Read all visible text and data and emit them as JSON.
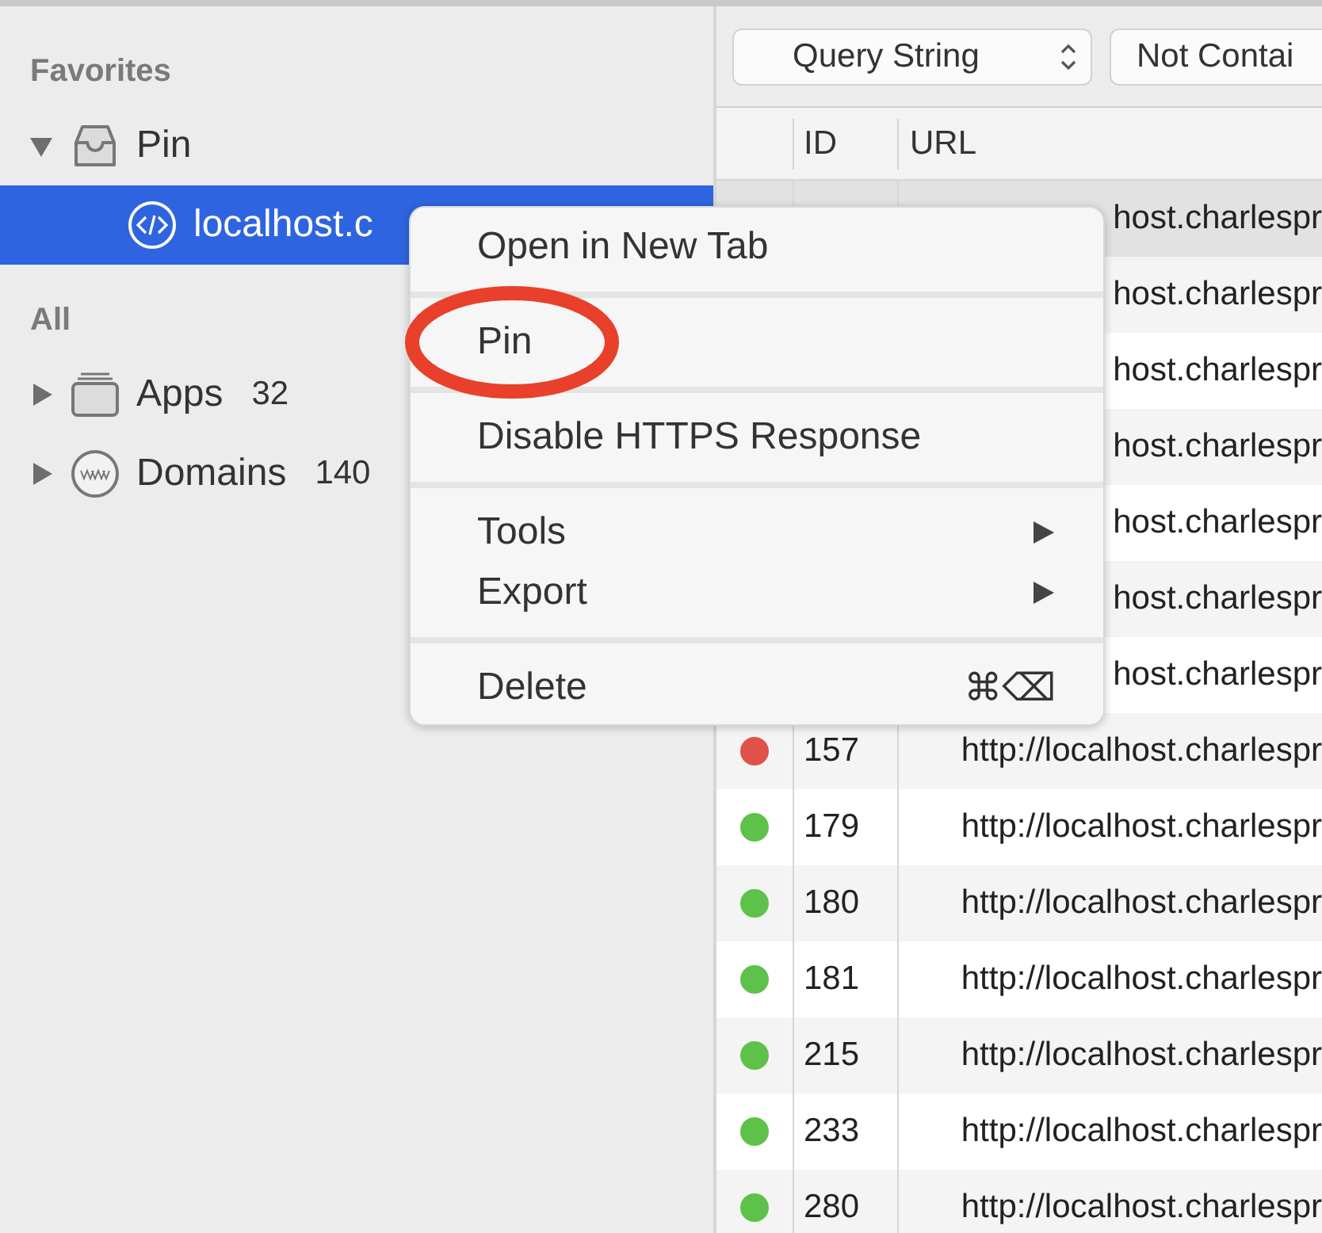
{
  "sidebar": {
    "sections": [
      {
        "title": "Favorites",
        "items": [
          {
            "label": "Pin",
            "expanded": true,
            "children": [
              {
                "label": "localhost.c",
                "selected": true
              }
            ]
          }
        ]
      },
      {
        "title": "All",
        "items": [
          {
            "label": "Apps",
            "expanded": false,
            "count": "32"
          },
          {
            "label": "Domains",
            "expanded": false,
            "count": "140"
          }
        ]
      }
    ]
  },
  "filter": {
    "field": "Query String",
    "operator": "Not Contai"
  },
  "table": {
    "columns": [
      "ID",
      "URL"
    ],
    "rows": [
      {
        "selected": true,
        "url": "host.charlespr"
      },
      {
        "selected": false,
        "url": "host.charlespr"
      },
      {
        "selected": false,
        "url": "host.charlespr"
      },
      {
        "selected": false,
        "url": "host.charlespr"
      },
      {
        "selected": false,
        "url": "host.charlespr"
      },
      {
        "selected": false,
        "url": "host.charlespr"
      },
      {
        "selected": false,
        "url": "host.charlespr"
      },
      {
        "selected": false,
        "color": "#e05249",
        "id": "157",
        "url": "http://localhost.charlespr"
      },
      {
        "selected": false,
        "color": "#5ec24a",
        "id": "179",
        "url": "http://localhost.charlespr"
      },
      {
        "selected": false,
        "color": "#5ec24a",
        "id": "180",
        "url": "http://localhost.charlespr"
      },
      {
        "selected": false,
        "color": "#5ec24a",
        "id": "181",
        "url": "http://localhost.charlespr"
      },
      {
        "selected": false,
        "color": "#5ec24a",
        "id": "215",
        "url": "http://localhost.charlespr"
      },
      {
        "selected": false,
        "color": "#5ec24a",
        "id": "233",
        "url": "http://localhost.charlespr"
      },
      {
        "selected": false,
        "color": "#5ec24a",
        "id": "280",
        "url": "http://localhost.charlespr"
      }
    ]
  },
  "context_menu": {
    "groups": [
      [
        {
          "label": "Open in New Tab",
          "highlighted": false
        }
      ],
      [
        {
          "label": "Pin",
          "highlighted": true
        }
      ],
      [
        {
          "label": "Disable HTTPS Response",
          "highlighted": false
        }
      ],
      [
        {
          "label": "Tools",
          "submenu": true,
          "highlighted": false
        },
        {
          "label": "Export",
          "submenu": true,
          "highlighted": false
        }
      ],
      [
        {
          "label": "Delete",
          "shortcut": "⌘⌫",
          "highlighted": false
        }
      ]
    ]
  }
}
